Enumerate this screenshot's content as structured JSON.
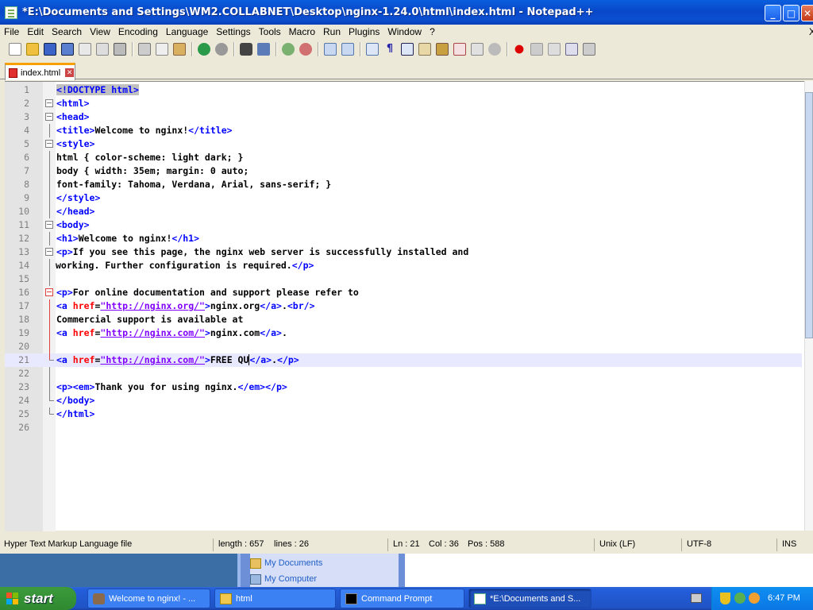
{
  "window": {
    "title": "*E:\\Documents and Settings\\WM2.COLLABNET\\Desktop\\nginx-1.24.0\\html\\index.html - Notepad++",
    "min": "_",
    "max": "□",
    "close": "✕"
  },
  "menu": [
    "File",
    "Edit",
    "Search",
    "View",
    "Encoding",
    "Language",
    "Settings",
    "Tools",
    "Macro",
    "Run",
    "Plugins",
    "Window",
    "?"
  ],
  "menu_close": "X",
  "tab": {
    "label": "index.html",
    "close": "✕"
  },
  "status": {
    "filetype": "Hyper Text Markup Language file",
    "length": "length : 657",
    "lines": "lines : 26",
    "ln": "Ln : 21",
    "col": "Col : 36",
    "pos": "Pos : 588",
    "eol": "Unix (LF)",
    "encoding": "UTF-8",
    "mode": "INS"
  },
  "desktop_popup": [
    "My Documents",
    "My Computer"
  ],
  "taskbar": {
    "start": "start",
    "tasks": [
      "Welcome to nginx! - ...",
      "html",
      "Command Prompt",
      "*E:\\Documents and S..."
    ],
    "clock": "6:47 PM"
  },
  "code": {
    "l1a": "<",
    "l1b": "!DOCTYPE html",
    ">": ">",
    "l2": "<html>",
    "l3": "<head>",
    "l4a": "<title>",
    "l4b": "Welcome to nginx!",
    "l4c": "</title>",
    "l5": "<style>",
    "l6": "html { color-scheme: light dark; }",
    "l7": "body { width: 35em; margin: 0 auto;",
    "l8": "font-family: Tahoma, Verdana, Arial, sans-serif; }",
    "l9": "</style>",
    "l10": "</head>",
    "l11": "<body>",
    "l12a": "<h1>",
    "l12b": "Welcome to nginx!",
    "l12c": "</h1>",
    "l13a": "<p>",
    "l13b": "If you see this page, the nginx web server is successfully installed and",
    "l14a": "working. Further configuration is required.",
    "l14b": "</p>",
    "l16a": "<p>",
    "l16b": "For online documentation and support please refer to",
    "l17a": "<a ",
    "l17b": "href",
    "l17c": "=",
    "l17d": "\"http://nginx.org/\"",
    "l17e": ">",
    "l17f": "nginx.org",
    "l17g": "</a>",
    "l17h": ".",
    "l17i": "<br/>",
    "l18": "Commercial support is available at",
    "l19a": "<a ",
    "l19b": "href",
    "l19c": "=",
    "l19d": "\"http://nginx.com/\"",
    "l19e": ">",
    "l19f": "nginx.com",
    "l19g": "</a>",
    "l19h": ".",
    "l21a": "<a ",
    "l21b": "href",
    "l21c": "=",
    "l21d": "\"http://nginx.com/\"",
    "l21e": ">",
    "l21f": "FREE QU",
    "l21g": "</a>",
    "l21h": ".",
    "l21i": "</p>",
    "l23a": "<p><em>",
    "l23b": "Thank you for using nginx.",
    "l23c": "</em></p>",
    "l24": "</body>",
    "l25": "</html>"
  },
  "line_numbers": [
    "1",
    "2",
    "3",
    "4",
    "5",
    "6",
    "7",
    "8",
    "9",
    "10",
    "11",
    "12",
    "13",
    "14",
    "15",
    "16",
    "17",
    "18",
    "19",
    "20",
    "21",
    "22",
    "23",
    "24",
    "25",
    "26"
  ]
}
